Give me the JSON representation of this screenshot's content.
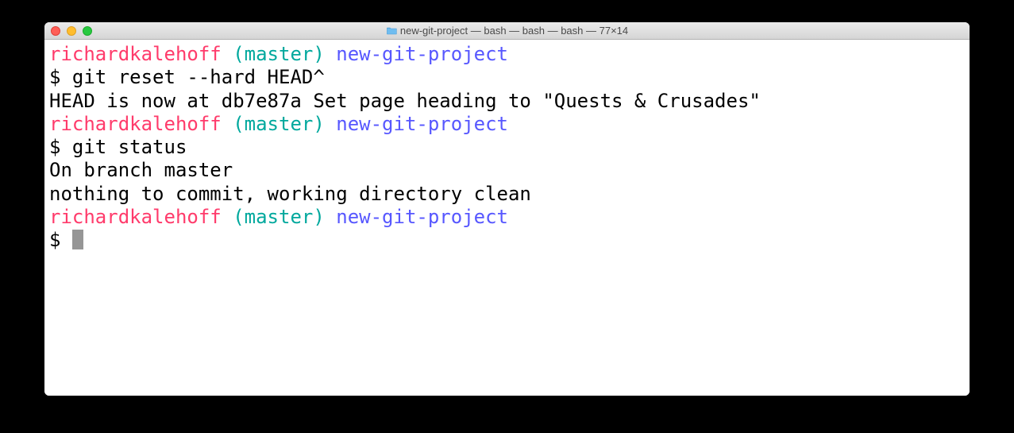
{
  "window": {
    "title": "new-git-project — bash — bash — bash — 77×14"
  },
  "prompt": {
    "user": "richardkalehoff",
    "branch": "(master)",
    "dir": "new-git-project",
    "symbol": "$"
  },
  "session": {
    "cmd1": "git reset --hard HEAD^",
    "out1": "HEAD is now at db7e87a Set page heading to \"Quests & Crusades\"",
    "cmd2": "git status",
    "out2a": "On branch master",
    "out2b": "nothing to commit, working directory clean"
  }
}
